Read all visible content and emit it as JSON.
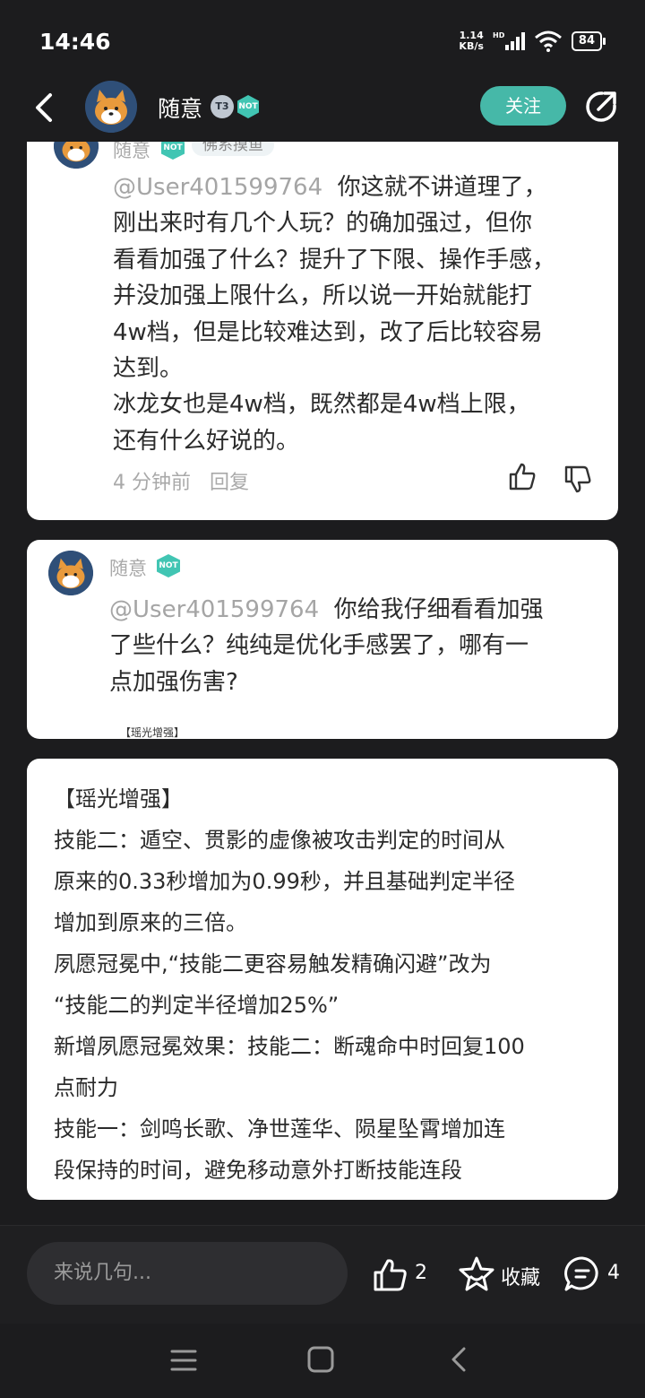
{
  "status_bar": {
    "time": "14:46",
    "net_speed_value": "1.14",
    "net_speed_unit": "KB/s",
    "signal_label": "HD",
    "battery": "84"
  },
  "header": {
    "username": "随意",
    "badge_level": "T3",
    "badge_not": "NOT",
    "follow_label": "关注"
  },
  "comments": [
    {
      "name": "随意",
      "tag": "佛系摸鱼",
      "mention": "@User401599764",
      "lines": [
        "你这就不讲道理了，",
        "刚出来时有几个人玩？的确加强过，但你",
        "看看加强了什么？提升了下限、操作手感，",
        "并没加强上限什么，所以说一开始就能打",
        "4w档，但是比较难达到，改了后比较容易",
        "达到。",
        "冰龙女也是4w档，既然都是4w档上限，",
        "还有什么好说的。"
      ],
      "time": "4 分钟前",
      "reply_label": "回复"
    },
    {
      "name": "随意",
      "mention": "@User401599764",
      "lines": [
        "你给我仔细看看加强",
        "了些什么？纯纯是优化手感罢了，哪有一",
        "点加强伤害?"
      ],
      "caption": "【瑶光增强】"
    }
  ],
  "detail": {
    "lines": [
      "【瑶光增强】",
      "技能二：遁空、贯影的虚像被攻击判定的时间从",
      "原来的0.33秒增加为0.99秒，并且基础判定半径",
      "增加到原来的三倍。",
      "夙愿冠冕中,“技能二更容易触发精确闪避”改为",
      "“技能二的判定半径增加25%”",
      "新增夙愿冠冕效果：技能二：断魂命中时回复100",
      "点耐力",
      "技能一：剑鸣长歌、净世莲华、陨星坠霄增加连",
      "段保持的时间，避免移动意外打断技能连段"
    ]
  },
  "bottom_bar": {
    "input_placeholder": "来说几句...",
    "like_count": "2",
    "collect_label": "收藏",
    "comment_count": "4"
  }
}
